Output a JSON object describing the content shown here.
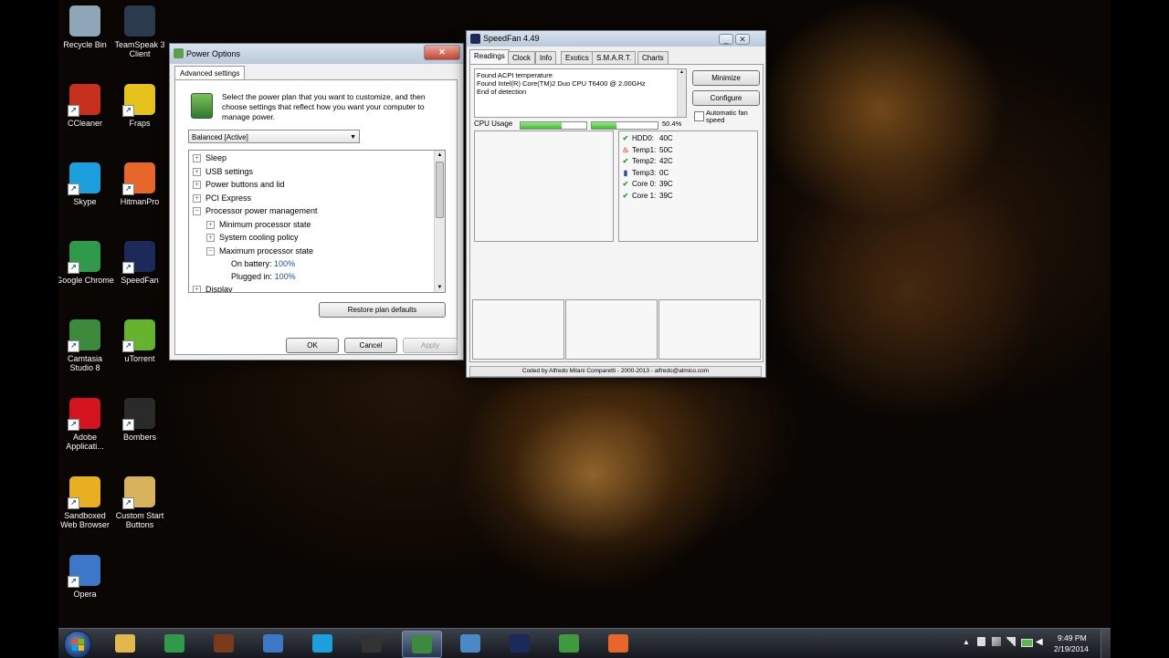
{
  "desktop": {
    "icons": [
      {
        "label": "Recycle Bin",
        "icon": "recycle-bin-icon",
        "color": "#8fa6b8"
      },
      {
        "label": "TeamSpeak 3 Client",
        "icon": "teamspeak-icon",
        "color": "#2b3a4d"
      },
      {
        "label": "CCleaner",
        "icon": "ccleaner-icon",
        "color": "#c8301e"
      },
      {
        "label": "Fraps",
        "icon": "fraps-icon",
        "color": "#e6c21c"
      },
      {
        "label": "Skype",
        "icon": "skype-icon",
        "color": "#1ca0dd"
      },
      {
        "label": "HitmanPro",
        "icon": "hitmanpro-icon",
        "color": "#e7672a"
      },
      {
        "label": "Google Chrome",
        "icon": "chrome-icon",
        "color": "#2f9b4a"
      },
      {
        "label": "SpeedFan",
        "icon": "speedfan-icon",
        "color": "#1c2a5a"
      },
      {
        "label": "Camtasia Studio 8",
        "icon": "camtasia-icon",
        "color": "#3c8a3c"
      },
      {
        "label": "uTorrent",
        "icon": "utorrent-icon",
        "color": "#66b32e"
      },
      {
        "label": "Adobe Applicati...",
        "icon": "adobe-icon",
        "color": "#d4141c"
      },
      {
        "label": "Bombers",
        "icon": "bombers-icon",
        "color": "#2a2a2a"
      },
      {
        "label": "Sandboxed Web Browser",
        "icon": "sandboxie-icon",
        "color": "#e8b020"
      },
      {
        "label": "Custom Start Buttons",
        "icon": "folder-icon",
        "color": "#d9b25c"
      },
      {
        "label": "Opera",
        "icon": "opera-icon",
        "color": "#3d78c8"
      }
    ]
  },
  "power_options": {
    "title": "Power Options",
    "tab": "Advanced settings",
    "description": "Select the power plan that you want to customize, and then choose settings that reflect how you want your computer to manage power.",
    "plan_select": "Balanced [Active]",
    "tree": [
      {
        "label": "Sleep",
        "exp": "+",
        "indent": 0
      },
      {
        "label": "USB settings",
        "exp": "+",
        "indent": 0
      },
      {
        "label": "Power buttons and lid",
        "exp": "+",
        "indent": 0
      },
      {
        "label": "PCI Express",
        "exp": "+",
        "indent": 0
      },
      {
        "label": "Processor power management",
        "exp": "−",
        "indent": 0
      },
      {
        "label": "Minimum processor state",
        "exp": "+",
        "indent": 1
      },
      {
        "label": "System cooling policy",
        "exp": "+",
        "indent": 1
      },
      {
        "label": "Maximum processor state",
        "exp": "−",
        "indent": 1
      }
    ],
    "on_battery_label": "On battery:",
    "on_battery_value": "100%",
    "plugged_in_label": "Plugged in:",
    "plugged_in_value": "100%",
    "partial_item": "Display",
    "restore_button": "Restore plan defaults",
    "ok_button": "OK",
    "cancel_button": "Cancel",
    "apply_button": "Apply"
  },
  "speedfan": {
    "title": "SpeedFan 4.49",
    "tabs": [
      "Readings",
      "Clock",
      "Info",
      "Exotics",
      "S.M.A.R.T.",
      "Charts"
    ],
    "log": [
      "Found ACPI temperature",
      "Found Intel(R) Core(TM)2 Duo CPU T6400 @ 2.00GHz",
      "End of detection"
    ],
    "minimize_button": "Minimize",
    "configure_button": "Configure",
    "auto_fan_label": "Automatic fan speed",
    "cpu_usage_label": "CPU Usage",
    "cpu_usage_value": "50.4%",
    "cpu_core_usage": [
      0.62,
      0.38
    ],
    "temps": [
      {
        "name": "HDD0:",
        "value": "40C",
        "icon": "check-icon"
      },
      {
        "name": "Temp1:",
        "value": "50C",
        "icon": "flame-icon"
      },
      {
        "name": "Temp2:",
        "value": "42C",
        "icon": "check-icon"
      },
      {
        "name": "Temp3:",
        "value": "0C",
        "icon": "thermometer-icon"
      },
      {
        "name": "Core 0:",
        "value": "39C",
        "icon": "check-icon"
      },
      {
        "name": "Core 1:",
        "value": "39C",
        "icon": "check-icon"
      }
    ],
    "footer": "Coded by Alfredo Milani Comparetti - 2000-2013 - alfredo@almico.com"
  },
  "taskbar": {
    "items": [
      {
        "icon": "folder-icon",
        "color": "#e2b74c",
        "active": false
      },
      {
        "icon": "chrome-icon",
        "color": "#2f9b4a",
        "active": false
      },
      {
        "icon": "game-icon",
        "color": "#7a3a1c",
        "active": false
      },
      {
        "icon": "opera-icon",
        "color": "#3d78c8",
        "active": false
      },
      {
        "icon": "skype-icon",
        "color": "#1ca0dd",
        "active": false
      },
      {
        "icon": "bombers-icon",
        "color": "#333333",
        "active": false
      },
      {
        "icon": "camtasia-icon",
        "color": "#3c8a3c",
        "active": true
      },
      {
        "icon": "monitor-icon",
        "color": "#4a88c8",
        "active": false
      },
      {
        "icon": "speedfan-icon",
        "color": "#1c2a5a",
        "active": false
      },
      {
        "icon": "battery-icon",
        "color": "#3f9a3f",
        "active": false
      },
      {
        "icon": "hitmanpro-icon",
        "color": "#e7672a",
        "active": false
      }
    ],
    "time": "9:49 PM",
    "date": "2/19/2014"
  }
}
